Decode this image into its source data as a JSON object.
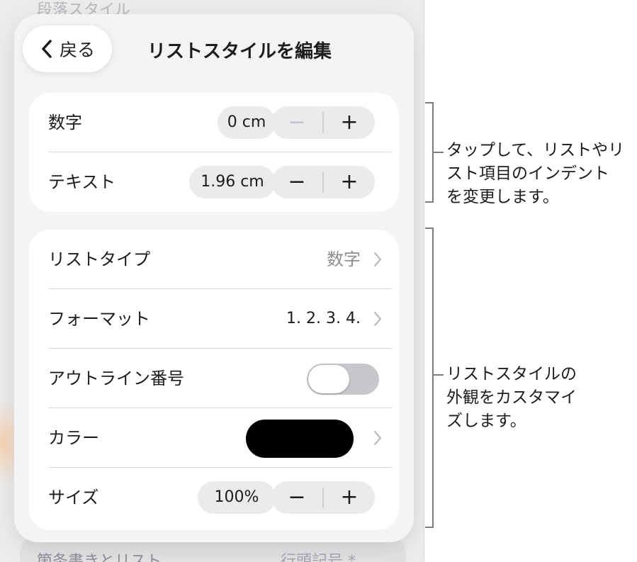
{
  "background": {
    "top_text": "段落スタイル",
    "bottom_left": "箇条書きとリスト",
    "bottom_right": "行頭記号 *"
  },
  "sheet": {
    "back_label": "戻る",
    "title": "リストスタイルを編集"
  },
  "indent": {
    "number": {
      "label": "数字",
      "value": "0 cm",
      "minus": "−",
      "plus": "+"
    },
    "text": {
      "label": "テキスト",
      "value": "1.96 cm",
      "minus": "−",
      "plus": "+"
    }
  },
  "style": {
    "list_type": {
      "label": "リストタイプ",
      "value": "数字"
    },
    "format": {
      "label": "フォーマット",
      "value": "1. 2. 3. 4."
    },
    "outline_numbering": {
      "label": "アウトライン番号",
      "on": false
    },
    "color": {
      "label": "カラー",
      "swatch": "#000000"
    },
    "size": {
      "label": "サイズ",
      "value": "100%",
      "minus": "−",
      "plus": "+"
    }
  },
  "callouts": {
    "indent": "タップして、リストやリ\nスト項目のインデント\nを変更します。",
    "style": "リストスタイルの\n外観をカスタマイ\nズします。"
  },
  "colors": {
    "sheet_bg": "#f4f4f6",
    "card_bg": "#ffffff",
    "control_bg": "#ebebee",
    "toggle_off": "#c7c7cc",
    "disabled_text": "#c2c2c6"
  }
}
